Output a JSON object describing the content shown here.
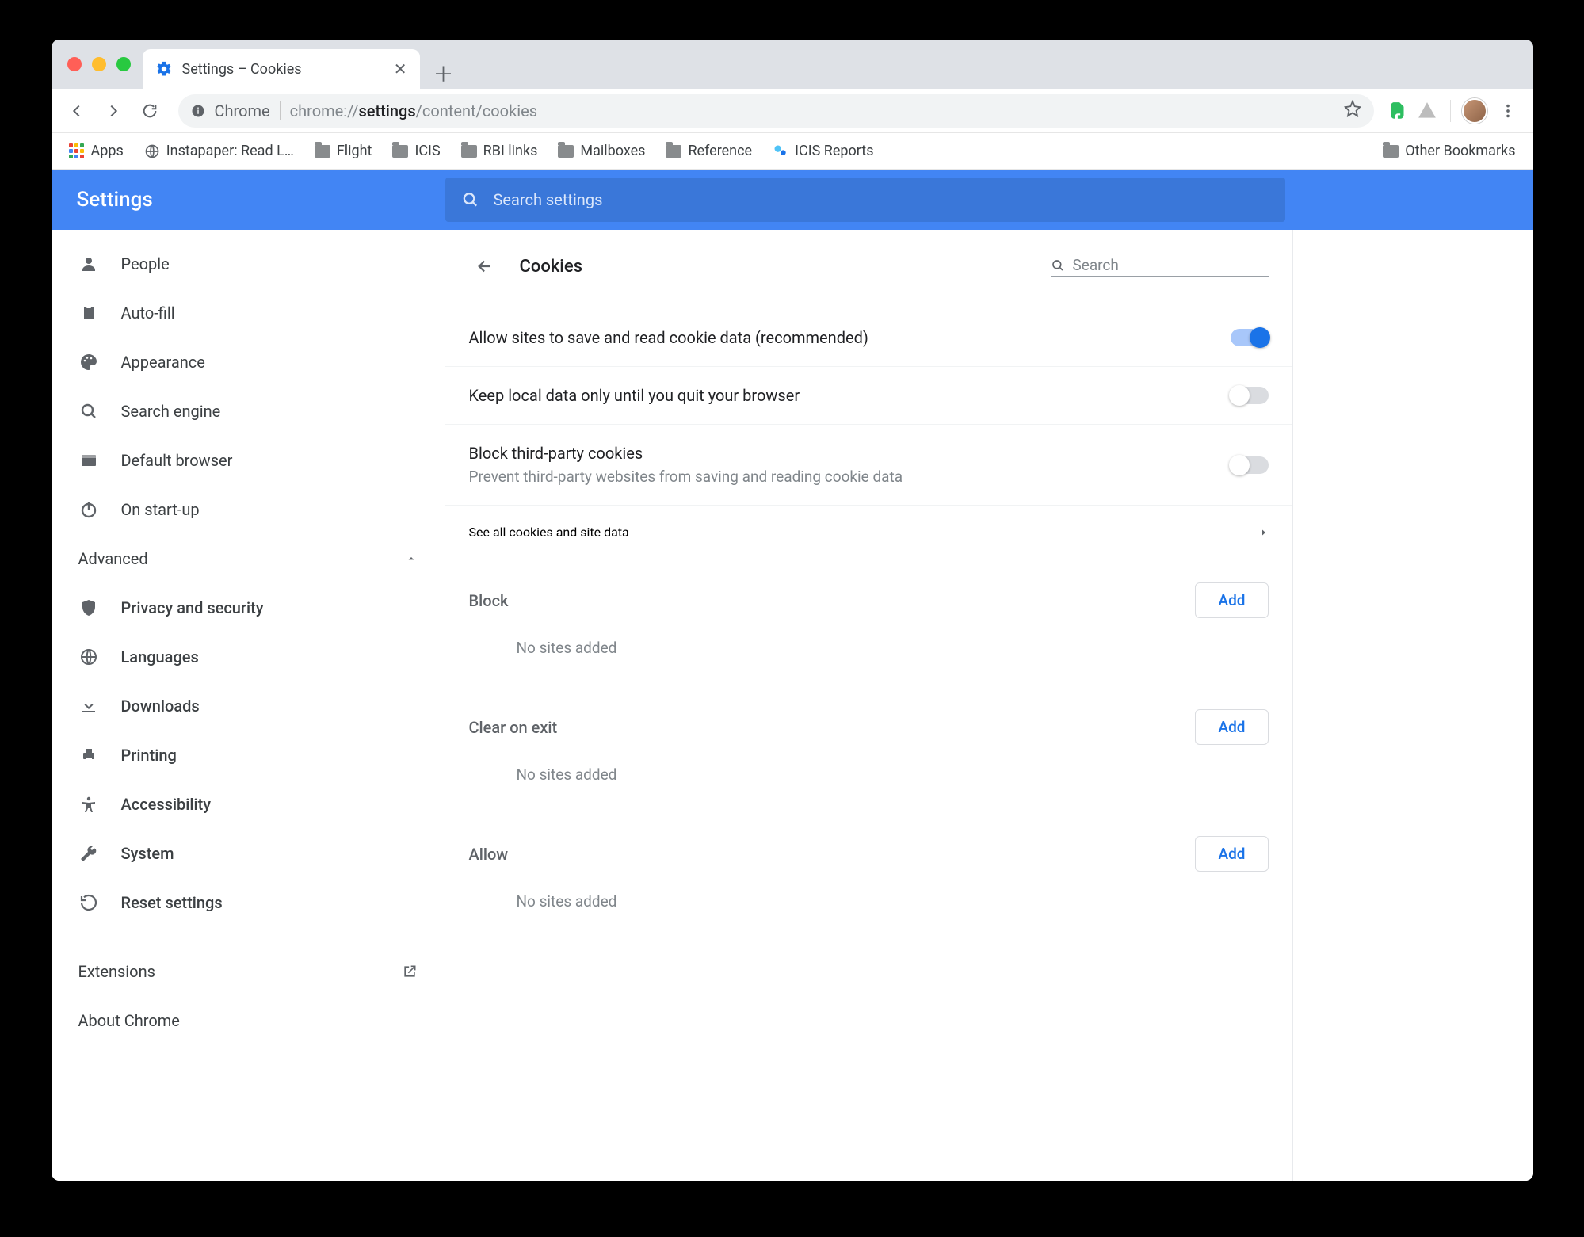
{
  "tab": {
    "title": "Settings – Cookies"
  },
  "omnibox": {
    "chrome_label": "Chrome",
    "url_prefix": "chrome://",
    "url_bold": "settings",
    "url_suffix": "/content/cookies"
  },
  "bookmarks": {
    "apps": "Apps",
    "items": [
      "Instapaper: Read L…",
      "Flight",
      "ICIS",
      "RBI links",
      "Mailboxes",
      "Reference",
      "ICIS Reports"
    ],
    "other": "Other Bookmarks"
  },
  "header": {
    "title": "Settings",
    "search_placeholder": "Search settings"
  },
  "sidebar": {
    "items": [
      "People",
      "Auto-fill",
      "Appearance",
      "Search engine",
      "Default browser",
      "On start-up"
    ],
    "advanced": "Advanced",
    "advanced_items": [
      "Privacy and security",
      "Languages",
      "Downloads",
      "Printing",
      "Accessibility",
      "System",
      "Reset settings"
    ],
    "extensions": "Extensions",
    "about": "About Chrome"
  },
  "page": {
    "title": "Cookies",
    "search_placeholder": "Search",
    "rows": {
      "allow": "Allow sites to save and read cookie data (recommended)",
      "keep": "Keep local data only until you quit your browser",
      "block3p": "Block third-party cookies",
      "block3p_sub": "Prevent third-party websites from saving and reading cookie data",
      "see_all": "See all cookies and site data"
    },
    "sections": {
      "block": "Block",
      "clear": "Clear on exit",
      "allow": "Allow",
      "add": "Add",
      "empty": "No sites added"
    }
  }
}
